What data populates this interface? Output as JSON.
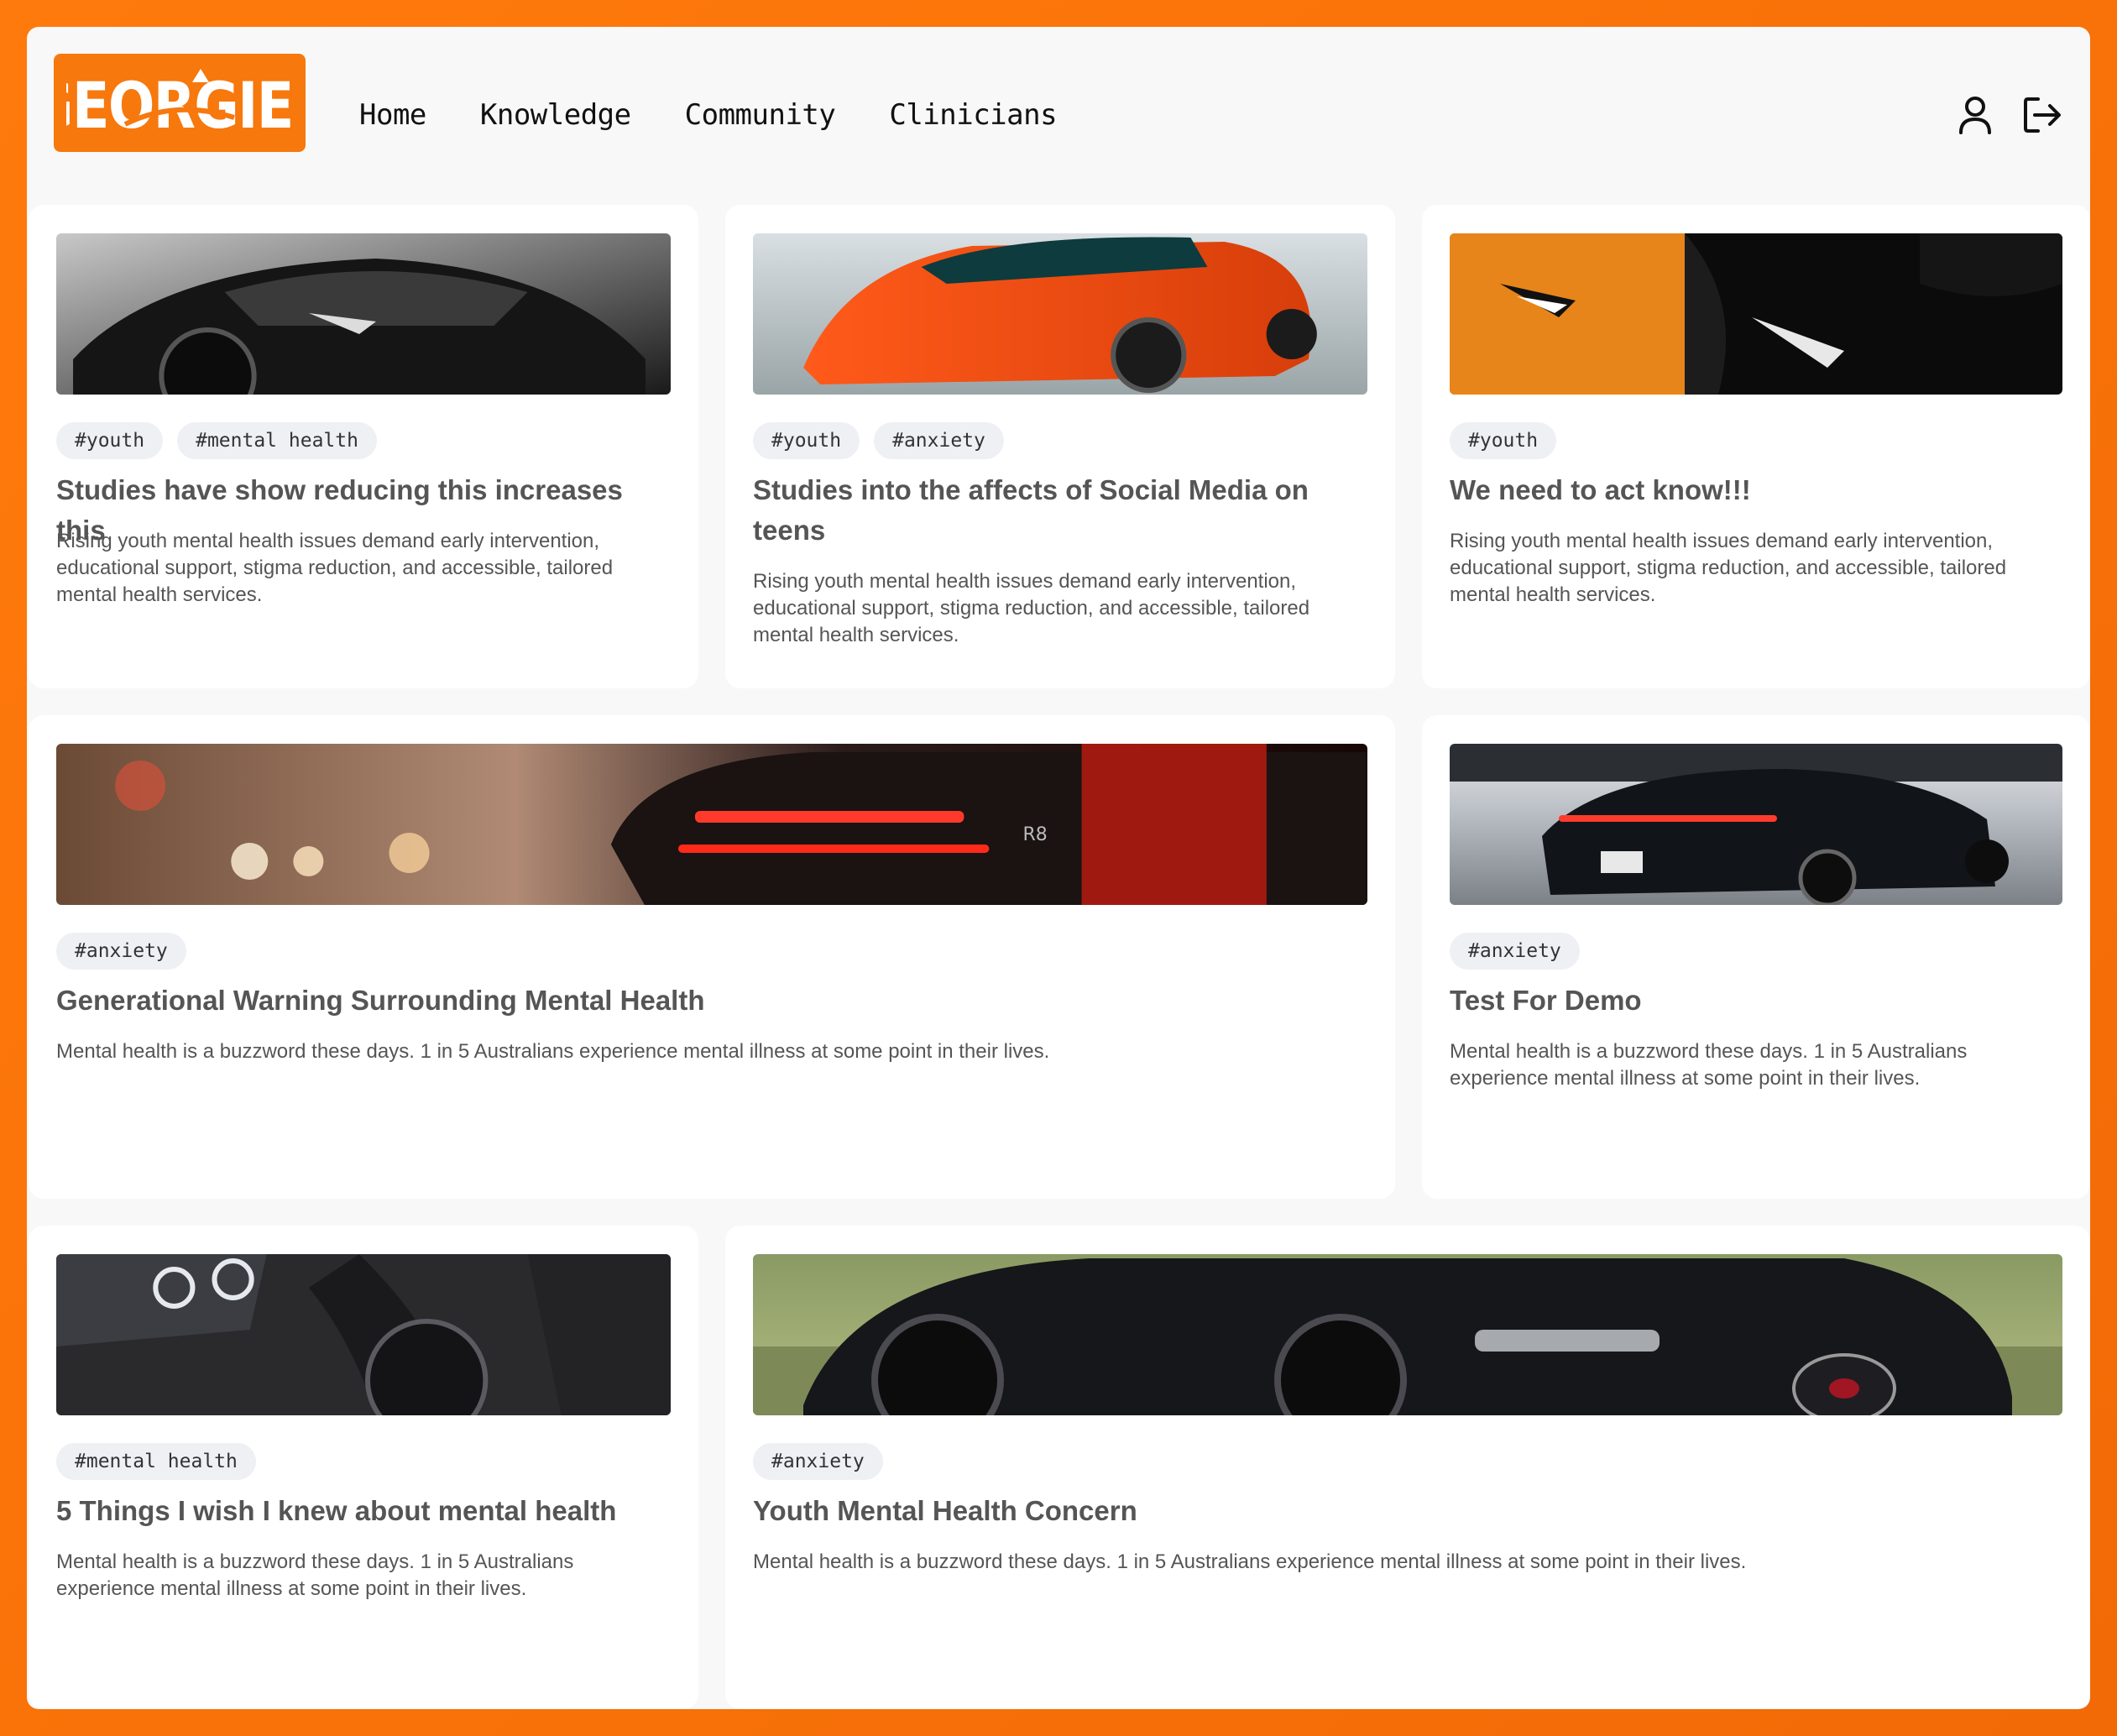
{
  "header": {
    "logo_text": "GEORGIES",
    "nav": [
      "Home",
      "Knowledge",
      "Community",
      "Clinicians"
    ],
    "icons": [
      "user-icon",
      "logout-icon"
    ]
  },
  "colors": {
    "brand_orange": "#f7780d",
    "background": "#f8f8f8",
    "card": "#ffffff",
    "tag_bg": "#eef0f4"
  },
  "cards": [
    {
      "image": "black lamborghini front",
      "tags": [
        "#youth",
        "#mental health"
      ],
      "title": "Studies have show reducing this increases this",
      "desc": "Rising youth mental health issues demand early intervention, educational support, stigma reduction, and accessible, tailored mental health services."
    },
    {
      "image": "orange mclaren supercar",
      "tags": [
        "#youth",
        "#anxiety"
      ],
      "title": "Studies into the affects of Social Media on teens",
      "desc": "Rising youth mental health issues demand early intervention, educational support, stigma reduction, and accessible, tailored mental health services."
    },
    {
      "image": "orange and black lamborghini headlights",
      "tags": [
        "#youth"
      ],
      "title": "We need to act know!!!",
      "desc": "Rising youth mental health issues demand early intervention, educational support, stigma reduction, and accessible, tailored mental health services."
    },
    {
      "image": "audi r8 tail lights at night",
      "tags": [
        "#anxiety"
      ],
      "title": "Generational Warning Surrounding Mental Health",
      "desc": "Mental health is a buzzword these days. 1 in 5 Australians experience mental illness at some point in their lives."
    },
    {
      "image": "black porsche panamera on road",
      "tags": [
        "#anxiety"
      ],
      "title": "Test For Demo",
      "desc": "Mental health is a buzzword these days. 1 in 5 Australians experience mental illness at some point in their lives."
    },
    {
      "image": "dark bmw headlight and wheel",
      "tags": [
        "#mental health"
      ],
      "title": "5 Things I wish I knew about mental health",
      "desc": "Mental health is a buzzword these days. 1 in 5 Australians experience mental illness at some point in their lives."
    },
    {
      "image": "black bugatti side view",
      "tags": [
        "#anxiety"
      ],
      "title": "Youth Mental Health Concern",
      "desc": "Mental health is a buzzword these days. 1 in 5 Australians experience mental illness at some point in their lives."
    }
  ]
}
